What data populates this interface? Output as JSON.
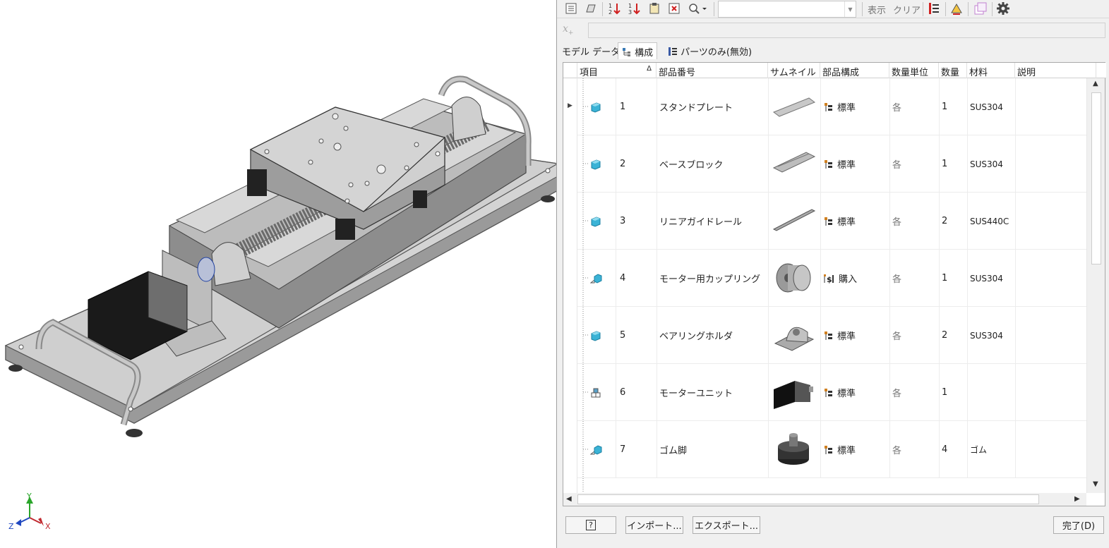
{
  "toolbar": {
    "view_label": "表示",
    "clear_label": "クリア"
  },
  "tabs": [
    {
      "label": "モデル データ"
    },
    {
      "label": "構成"
    },
    {
      "label": "パーツのみ(無効)"
    }
  ],
  "columns": [
    "項目",
    "部品番号",
    "サムネイル",
    "部品構成",
    "数量単位",
    "数量",
    "材料",
    "説明"
  ],
  "sort_indicator": "Δ",
  "rows": [
    {
      "item": "1",
      "part_number": "スタンドプレート",
      "bom_structure": "標準",
      "unit": "各",
      "qty": "1",
      "material": "SUS304",
      "thumb": "plate-thumbnail"
    },
    {
      "item": "2",
      "part_number": "ベースブロック",
      "bom_structure": "標準",
      "unit": "各",
      "qty": "1",
      "material": "SUS304",
      "thumb": "block-thumbnail"
    },
    {
      "item": "3",
      "part_number": "リニアガイドレール",
      "bom_structure": "標準",
      "unit": "各",
      "qty": "2",
      "material": "SUS440C",
      "thumb": "rail-thumbnail"
    },
    {
      "item": "4",
      "part_number": "モーター用カップリング",
      "bom_structure": "購入",
      "unit": "各",
      "qty": "1",
      "material": "SUS304",
      "thumb": "coupling-thumbnail"
    },
    {
      "item": "5",
      "part_number": "ベアリングホルダ",
      "bom_structure": "標準",
      "unit": "各",
      "qty": "2",
      "material": "SUS304",
      "thumb": "bearing-holder-thumbnail"
    },
    {
      "item": "6",
      "part_number": "モーターユニット",
      "bom_structure": "標準",
      "unit": "各",
      "qty": "1",
      "material": "",
      "thumb": "motor-thumbnail"
    },
    {
      "item": "7",
      "part_number": "ゴム脚",
      "bom_structure": "標準",
      "unit": "各",
      "qty": "4",
      "material": "ゴム",
      "thumb": "rubber-foot-thumbnail"
    }
  ],
  "footer": {
    "help_label": "?",
    "import_label": "インポート...",
    "export_label": "エクスポート...",
    "done_label": "完了(D)"
  },
  "axis_labels": {
    "x": "X",
    "y": "Y",
    "z": "Z"
  },
  "colors": {
    "part_icon": "#3bb3d6",
    "assembly_icon": "#5aa0c8",
    "accent_red": "#d02020",
    "axis_x": "#c0282e",
    "axis_y": "#2aa52a",
    "axis_z": "#2048c0"
  }
}
